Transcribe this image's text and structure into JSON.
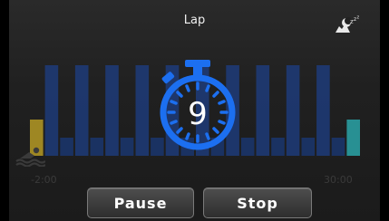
{
  "header": {
    "title": "Lap",
    "sleep_icon": "sleep-zzz-icon"
  },
  "chart_data": {
    "type": "bar",
    "x_start_label": "-2:00",
    "x_end_label": "30:00",
    "series": [
      {
        "values": [
          2,
          5,
          1,
          5,
          1,
          5,
          1,
          5,
          1,
          5,
          1,
          5,
          1,
          5,
          1,
          5,
          1,
          5,
          1,
          5,
          1,
          2
        ]
      }
    ],
    "colors": {
      "edge_bar": "#b59a24",
      "end_bar": "#2aa4a8",
      "tall_bar": "#1d3f86",
      "short_bar": "#1a3a7a"
    }
  },
  "stopwatch": {
    "value": "9",
    "color": "#1c6ff0"
  },
  "status": {
    "swim_icon": "swimmer-icon"
  },
  "controls": {
    "pause_label": "Pause",
    "stop_label": "Stop"
  }
}
